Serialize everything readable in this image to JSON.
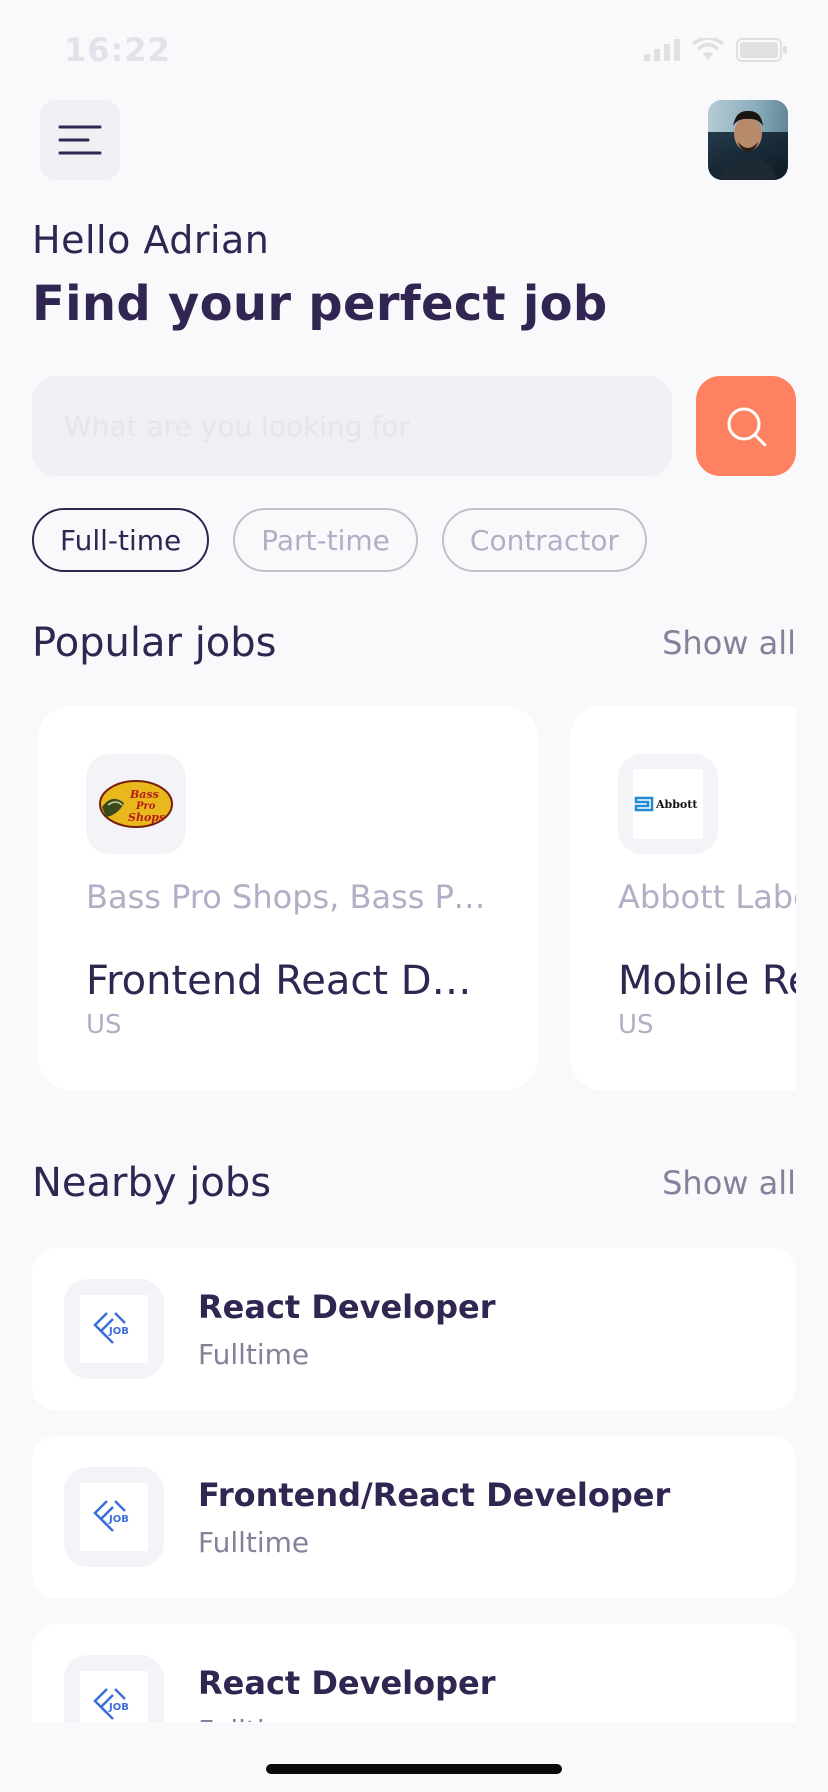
{
  "status_bar": {
    "time": "16:22"
  },
  "header": {},
  "welcome": {
    "greeting": "Hello Adrian",
    "headline": "Find your perfect job"
  },
  "search": {
    "placeholder": "What are you looking for",
    "value": ""
  },
  "tabs": [
    {
      "label": "Full-time",
      "active": true
    },
    {
      "label": "Part-time",
      "active": false
    },
    {
      "label": "Contractor",
      "active": false
    }
  ],
  "popular": {
    "title": "Popular jobs",
    "show_all": "Show all",
    "cards": [
      {
        "company": "Bass Pro Shops, Bass Pro...",
        "logo_text": "Bass Pro Shops",
        "title": "Frontend React Dev...",
        "location": "US"
      },
      {
        "company": "Abbott Labo",
        "logo_text": "Abbott",
        "title": "Mobile Re",
        "location": "US"
      }
    ]
  },
  "nearby": {
    "title": "Nearby jobs",
    "show_all": "Show all",
    "items": [
      {
        "title": "React Developer",
        "type": "Fulltime"
      },
      {
        "title": "Frontend/React Developer",
        "type": "Fulltime"
      },
      {
        "title": "React Developer",
        "type": "Fulltime"
      }
    ]
  },
  "colors": {
    "primary": "#312651",
    "accent": "#ff7754",
    "gray": "#83829a",
    "light": "#f9f9fc"
  }
}
